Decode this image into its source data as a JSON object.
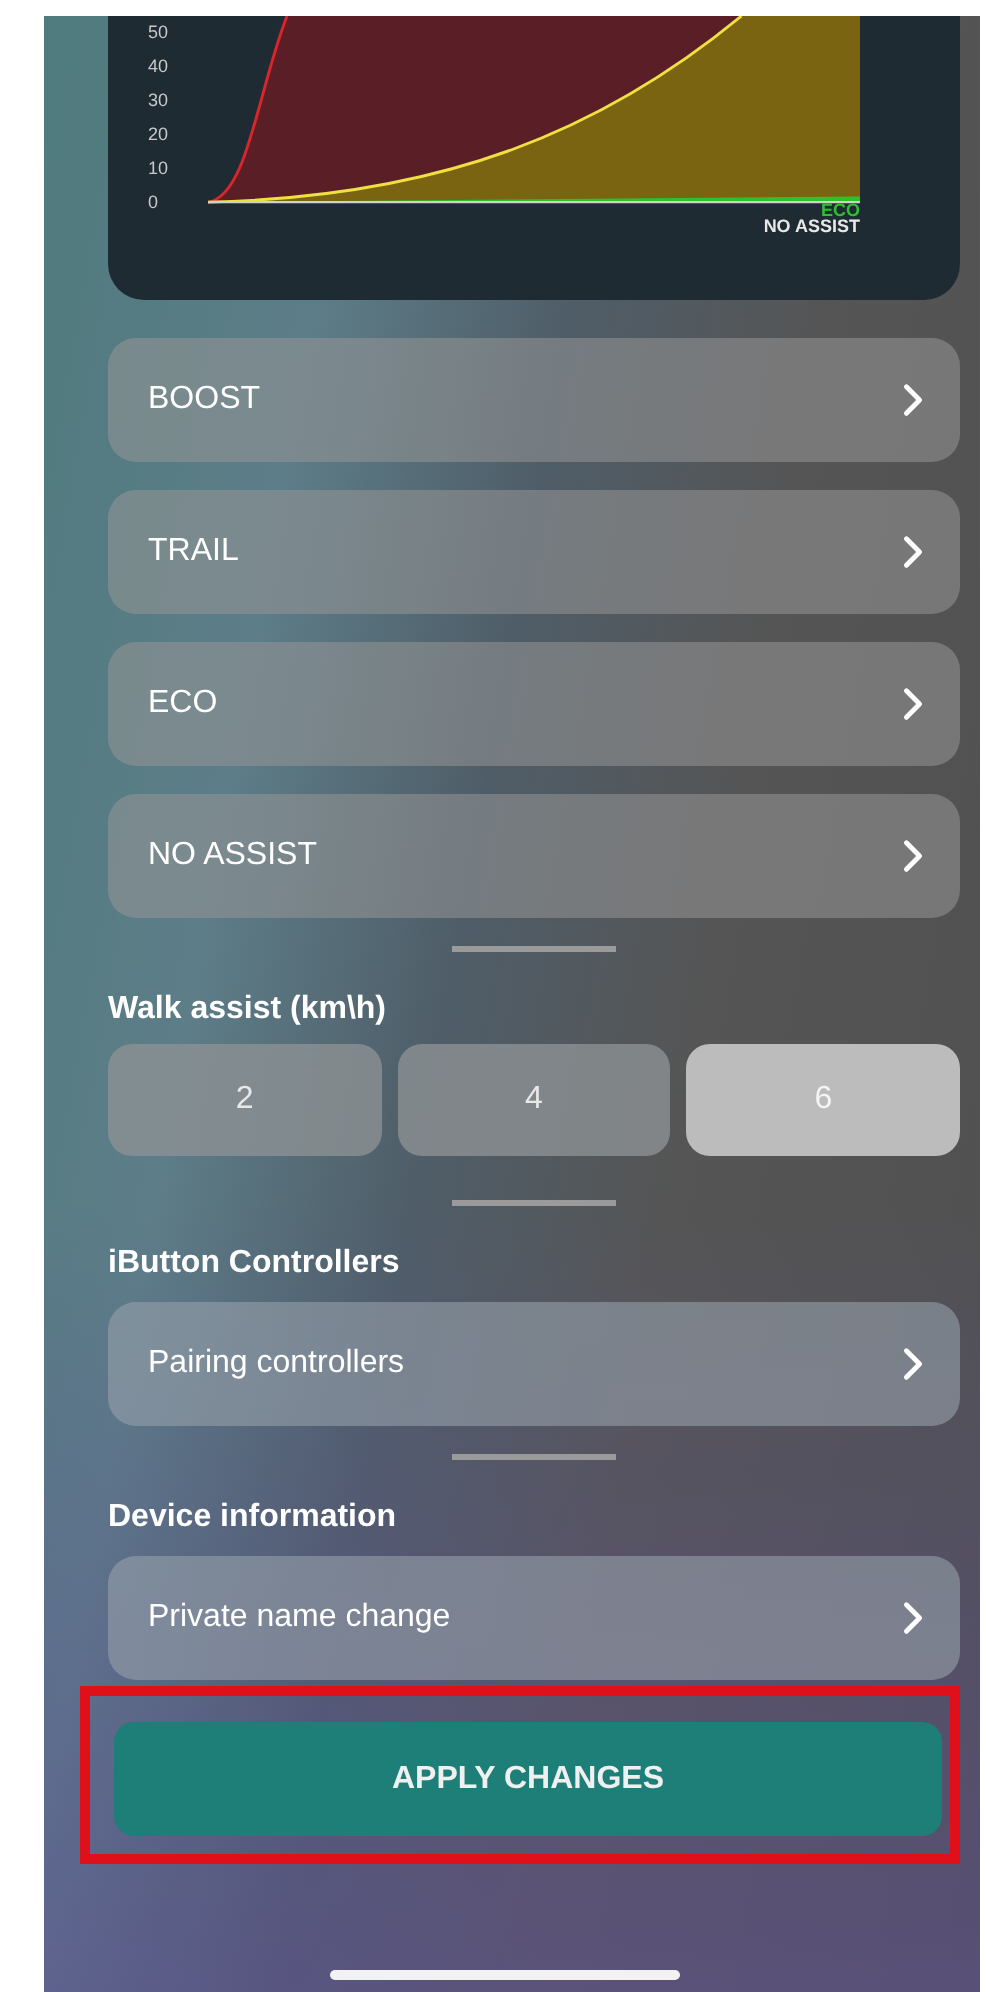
{
  "chart": {
    "y_ticks": [
      "50",
      "40",
      "30",
      "20",
      "10",
      "0"
    ],
    "series_labels": [
      {
        "text": "ECO",
        "color": "#2ec12e"
      },
      {
        "text": "NO ASSIST",
        "color": "#e8e8e8"
      }
    ]
  },
  "modes": [
    {
      "label": "BOOST"
    },
    {
      "label": "TRAIL"
    },
    {
      "label": "ECO"
    },
    {
      "label": "NO ASSIST"
    }
  ],
  "walk_assist": {
    "title": "Walk assist (km\\h)",
    "options": [
      {
        "label": "2",
        "selected": false
      },
      {
        "label": "4",
        "selected": false
      },
      {
        "label": "6",
        "selected": true
      }
    ]
  },
  "controllers": {
    "title": "iButton Controllers",
    "items": [
      {
        "label": "Pairing controllers"
      }
    ]
  },
  "device": {
    "title": "Device information",
    "items": [
      {
        "label": "Private name change"
      }
    ]
  },
  "apply_button": {
    "label": "APPLY CHANGES",
    "highlighted": true
  }
}
